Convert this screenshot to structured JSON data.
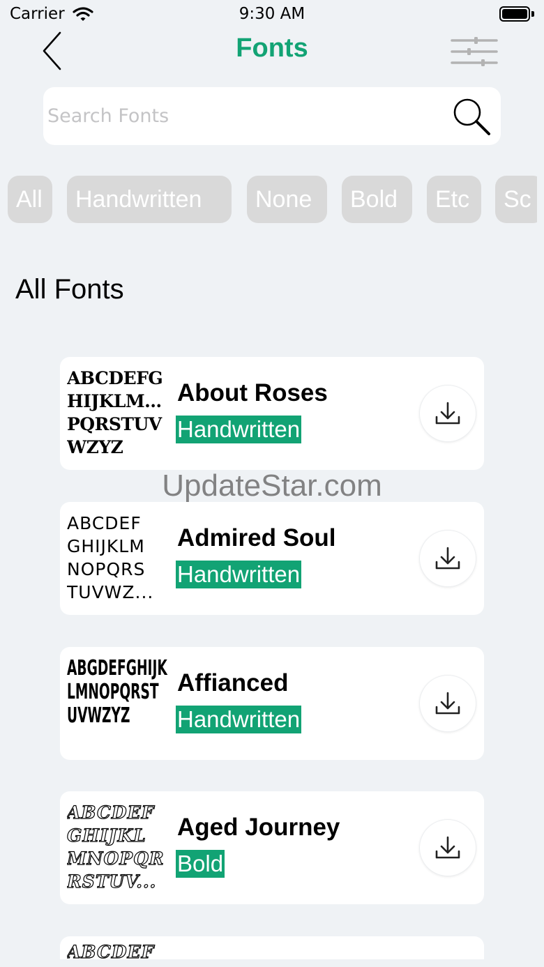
{
  "status_bar": {
    "carrier": "Carrier",
    "time": "9:30 AM"
  },
  "nav": {
    "title": "Fonts",
    "back_icon": "chevron-left-icon",
    "filter_icon": "sliders-icon"
  },
  "search": {
    "placeholder": "Search Fonts",
    "value": "",
    "icon": "search-icon"
  },
  "chips": [
    "All",
    "Handwritten",
    "None",
    "Bold",
    "Etc",
    "Sc"
  ],
  "section_title": "All Fonts",
  "fonts": [
    {
      "name": "About Roses",
      "tag": "Handwritten",
      "preview": [
        "ABCDEFG",
        "HIJKLMNO",
        "PQRSTUV",
        "WZYZ"
      ]
    },
    {
      "name": "Admired Soul",
      "tag": "Handwritten",
      "preview": [
        "ABCDEF",
        "GHIJKLM",
        "NOPQRS",
        "TUVWZ..."
      ]
    },
    {
      "name": "Affianced",
      "tag": "Handwritten",
      "preview": [
        "ABGDEFGHIJK",
        "LMNOPQRST",
        "UVWZYZ"
      ]
    },
    {
      "name": "Aged Journey",
      "tag": "Bold",
      "preview": [
        "ABCDEF",
        "GHIJKL",
        "MNOPQR",
        "RSTUV..."
      ]
    },
    {
      "name": "",
      "tag": "",
      "preview": [
        "ABCDEF"
      ]
    }
  ],
  "watermark": "UpdateStar.com",
  "colors": {
    "accent": "#12a374",
    "background": "#eff2f5",
    "chip": "#d9d9d9",
    "card": "#ffffff"
  }
}
